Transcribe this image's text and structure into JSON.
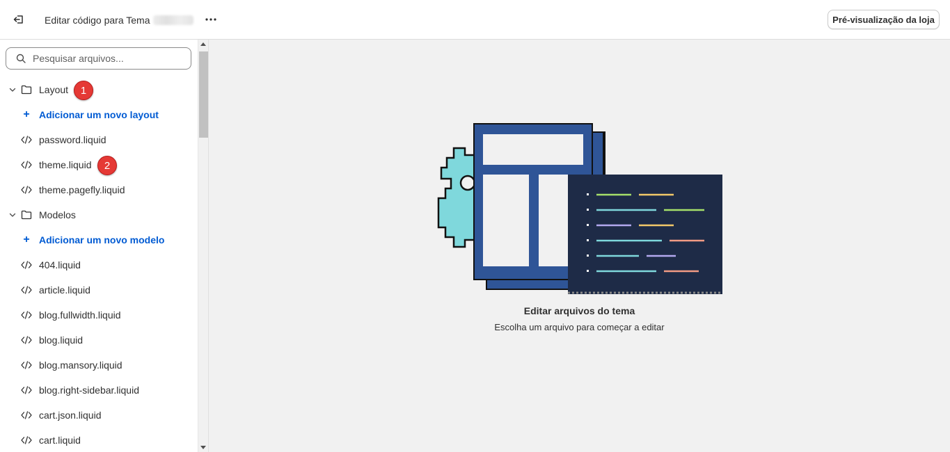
{
  "topbar": {
    "title": "Editar código para Tema",
    "preview_label": "Pré-visualização da loja"
  },
  "sidebar": {
    "search_placeholder": "Pesquisar arquivos...",
    "layout_folder": "Layout",
    "add_layout": "Adicionar um novo layout",
    "layout_files": [
      "password.liquid",
      "theme.liquid",
      "theme.pagefly.liquid"
    ],
    "models_folder": "Modelos",
    "add_model": "Adicionar um novo modelo",
    "model_files": [
      "404.liquid",
      "article.liquid",
      "blog.fullwidth.liquid",
      "blog.liquid",
      "blog.mansory.liquid",
      "blog.right-sidebar.liquid",
      "cart.json.liquid",
      "cart.liquid"
    ]
  },
  "badges": {
    "first": "1",
    "second": "2"
  },
  "main": {
    "empty_title": "Editar arquivos do tema",
    "empty_subtitle": "Escolha um arquivo para começar a editar"
  },
  "colors": {
    "accent_link": "#005bd3",
    "badge_red": "#e53935",
    "illus_blue": "#2f5597",
    "illus_dark": "#1e2b47",
    "gear_cyan": "#7fd8dc"
  }
}
